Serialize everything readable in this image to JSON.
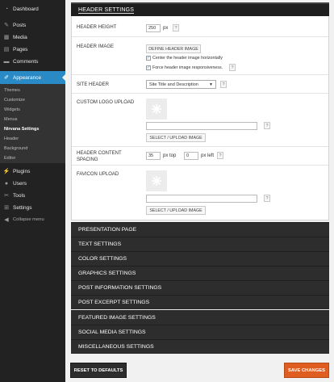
{
  "sidebar": {
    "items": [
      {
        "label": "Dashboard",
        "icon": "dashboard-icon"
      },
      {
        "label": "Posts",
        "icon": "pushpin-icon"
      },
      {
        "label": "Media",
        "icon": "media-icon"
      },
      {
        "label": "Pages",
        "icon": "pages-icon"
      },
      {
        "label": "Comments",
        "icon": "comments-icon"
      },
      {
        "label": "Appearance",
        "icon": "paintbrush-icon"
      },
      {
        "label": "Plugins",
        "icon": "plugin-icon"
      },
      {
        "label": "Users",
        "icon": "users-icon"
      },
      {
        "label": "Tools",
        "icon": "wrench-icon"
      },
      {
        "label": "Settings",
        "icon": "settings-icon"
      },
      {
        "label": "Collapse menu",
        "icon": "collapse-icon"
      }
    ],
    "submenu": [
      "Themes",
      "Customize",
      "Widgets",
      "Menus",
      "Nirvana Settings",
      "Header",
      "Background",
      "Editor"
    ],
    "active_color": "#2a8ac6"
  },
  "header_settings": {
    "title": "HEADER SETTINGS",
    "header_height": {
      "label": "HEADER HEIGHT",
      "value": "250",
      "unit": "px"
    },
    "header_image": {
      "label": "HEADER IMAGE",
      "button": "DEFINE HEADER IMAGE",
      "checkbox1": "Center the header image horizontally",
      "checkbox2": "Force header image responsiveness.",
      "checkbox1_checked": true,
      "checkbox2_checked": true
    },
    "site_header": {
      "label": "SITE HEADER",
      "selected": "Site Title and Description"
    },
    "custom_logo": {
      "label": "CUSTOM LOGO UPLOAD",
      "button": "SELECT / UPLOAD IMAGE",
      "value": ""
    },
    "content_spacing": {
      "label": "HEADER CONTENT SPACING",
      "top_value": "35",
      "top_unit": "px top",
      "left_value": "0",
      "left_unit": "px left"
    },
    "favicon": {
      "label": "FAVICON UPLOAD",
      "button": "SELECT / UPLOAD IMAGE",
      "value": ""
    },
    "help_label": "?"
  },
  "sections": [
    "PRESENTATION PAGE",
    "TEXT SETTINGS",
    "COLOR SETTINGS",
    "GRAPHICS SETTINGS",
    "POST INFORMATION SETTINGS",
    "POST EXCERPT SETTINGS",
    "FEATURED IMAGE SETTINGS",
    "SOCIAL MEDIA SETTINGS",
    "MISCELLANEOUS SETTINGS"
  ],
  "buttons": {
    "reset": "RESET TO DEFAULTS",
    "save": "SAVE CHANGES"
  },
  "colors": {
    "save": "#e05d22",
    "section_bg": "#2d2d2d"
  }
}
